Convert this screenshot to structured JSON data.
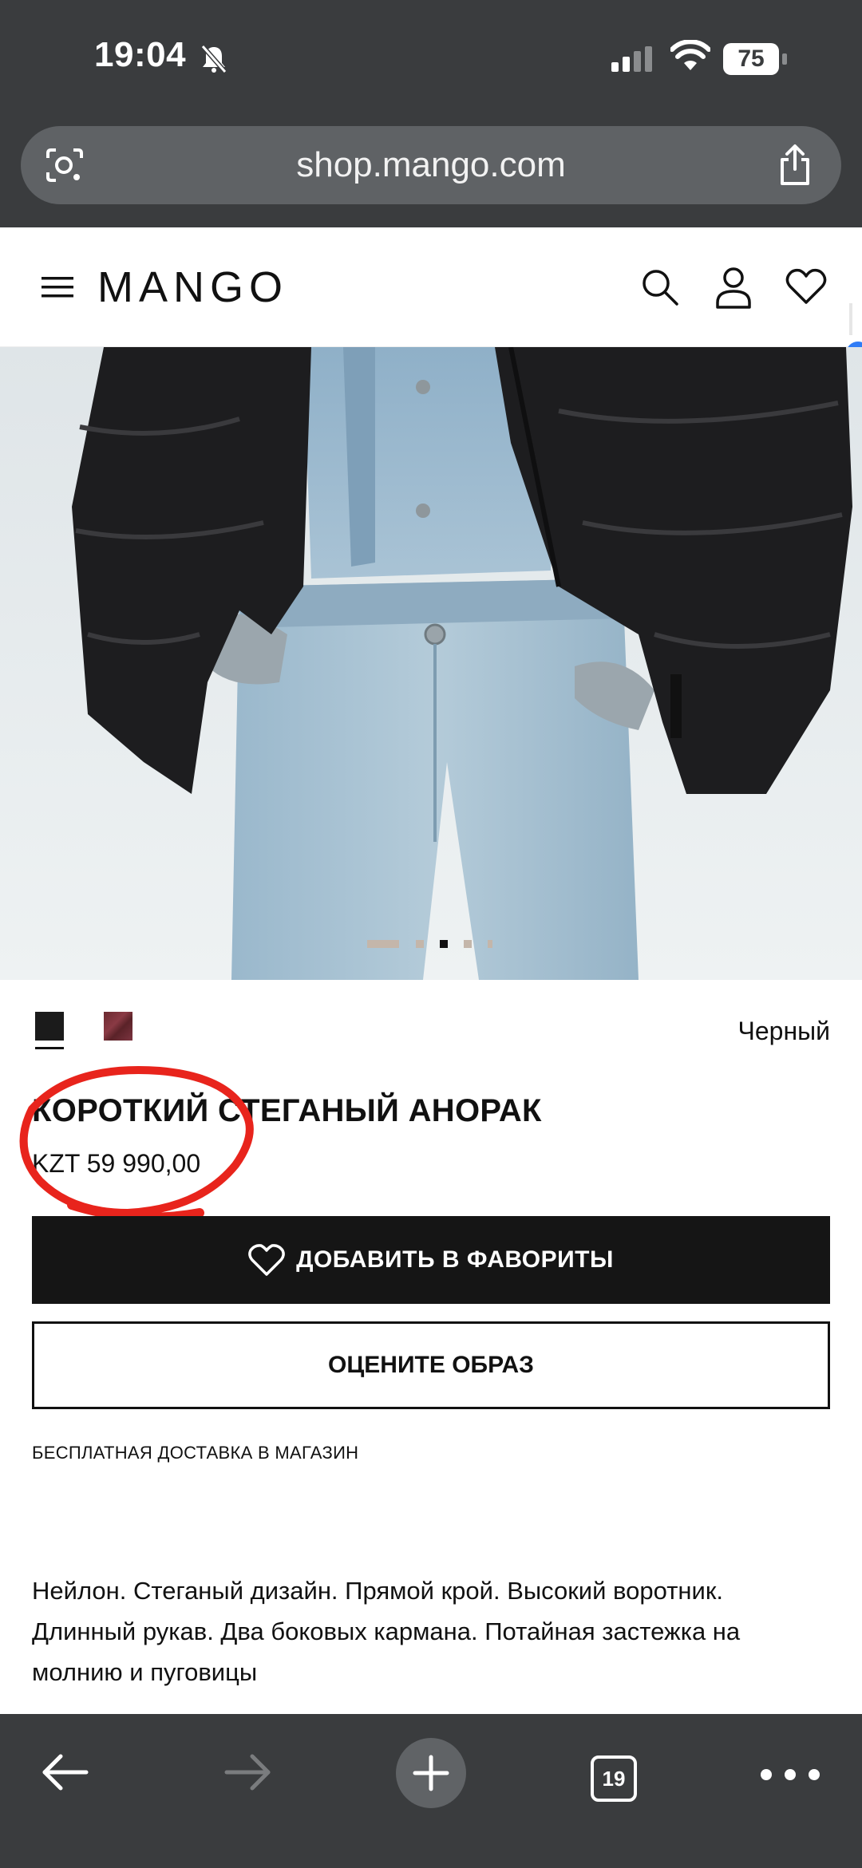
{
  "status_bar": {
    "time": "19:04",
    "battery": "75"
  },
  "browser": {
    "url": "shop.mango.com",
    "tab_count": "19"
  },
  "header": {
    "logo": "MANGO"
  },
  "product": {
    "color_name": "Черный",
    "title": "КОРОТКИЙ СТЕГАНЫЙ АНОРАК",
    "price": "KZT 59 990,00",
    "favorite_label": "ДОБАВИТЬ В ФАВОРИТЫ",
    "rate_label": "ОЦЕНИТЕ ОБРАЗ",
    "delivery": "БЕСПЛАТНАЯ ДОСТАВКА В МАГАЗИН",
    "description": "Нейлон. Стеганый дизайн. Прямой крой. Высокий воротник. Длинный рукав. Два боковых кармана. Потайная застежка на молнию и пуговицы"
  },
  "carousel": {
    "active_index": 2,
    "count": 5
  },
  "colors": {
    "accent_annotation": "#e8241c",
    "button_dark": "#151515",
    "browser_chrome": "#3a3c3e"
  }
}
